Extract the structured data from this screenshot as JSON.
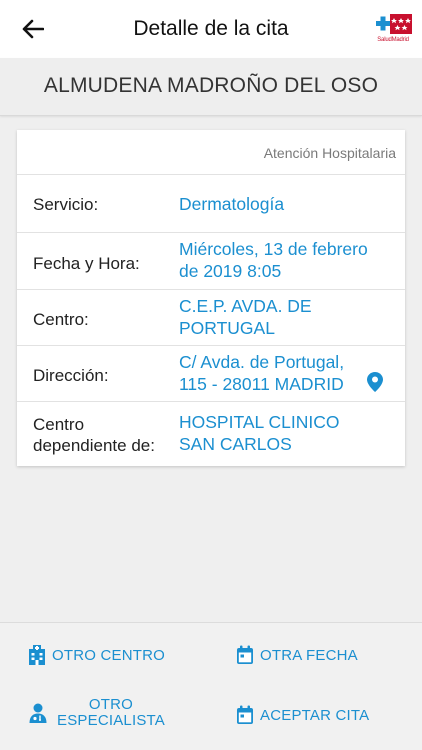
{
  "header": {
    "title": "Detalle de la cita",
    "back_icon": "arrow-left-icon",
    "logo_text": "SaludMadrid",
    "brand_color": "#c8102e"
  },
  "patient": {
    "name": "ALMUDENA MADROÑO DEL OSO"
  },
  "appointment": {
    "type": "Atención Hospitalaria",
    "rows": [
      {
        "label": "Servicio:",
        "value": "Dermatología"
      },
      {
        "label": "Fecha y Hora:",
        "value_line1": "Miércoles, 13 de febrero",
        "value_line2": "de 2019 8:05"
      },
      {
        "label": "Centro:",
        "value_line1": "C.E.P. AVDA. DE",
        "value_line2": "PORTUGAL"
      },
      {
        "label": "Dirección:",
        "value_line1": "C/ Avda. de Portugal,",
        "value_line2": "115 - 28011 MADRID",
        "icon": "location-pin-icon"
      },
      {
        "label_line1": "Centro",
        "label_line2": "dependiente de:",
        "value_line1": "HOSPITAL CLINICO",
        "value_line2": "SAN CARLOS"
      }
    ]
  },
  "actions": {
    "other_center": "OTRO CENTRO",
    "other_date": "OTRA FECHA",
    "other_specialist_line1": "OTRO",
    "other_specialist_line2": "ESPECIALISTA",
    "accept": "ACEPTAR CITA",
    "accent_color": "#1b8fd0"
  }
}
